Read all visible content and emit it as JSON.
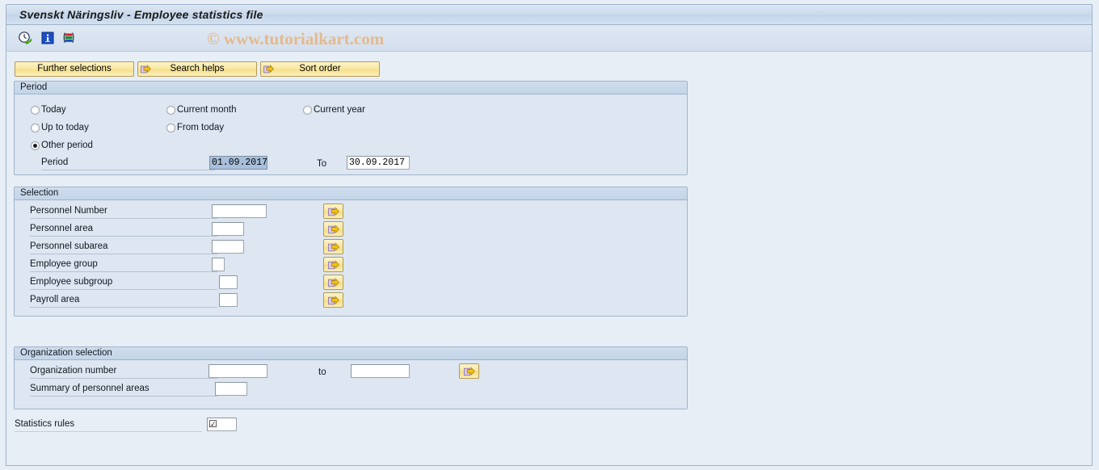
{
  "window": {
    "title": "Svenskt Näringsliv - Employee statistics file"
  },
  "toolbar": {
    "icons": [
      {
        "name": "execute-clock-icon",
        "title": "Execute"
      },
      {
        "name": "info-icon",
        "title": "Information"
      },
      {
        "name": "variant-icon",
        "title": "Get Variant"
      }
    ],
    "watermark": "© www.tutorialkart.com"
  },
  "buttons": [
    {
      "label": "Further selections",
      "icon": null
    },
    {
      "label": "Search helps",
      "icon": "arrow-right-icon"
    },
    {
      "label": "Sort order",
      "icon": "arrow-right-icon"
    }
  ],
  "period": {
    "title": "Period",
    "options": [
      {
        "label": "Today",
        "selected": false
      },
      {
        "label": "Current month",
        "selected": false
      },
      {
        "label": "Current year",
        "selected": false
      },
      {
        "label": "Up to today",
        "selected": false
      },
      {
        "label": "From today",
        "selected": false
      },
      {
        "label": "Other period",
        "selected": true
      }
    ],
    "period_label": "Period",
    "period_from": "01.09.2017",
    "to_label": "To",
    "period_to": "30.09.2017"
  },
  "selection": {
    "title": "Selection",
    "rows": [
      {
        "label": "Personnel Number",
        "value": "",
        "field_width": 68
      },
      {
        "label": "Personnel area",
        "value": "",
        "field_width": 40
      },
      {
        "label": "Personnel subarea",
        "value": "",
        "field_width": 40
      },
      {
        "label": "Employee group",
        "value": "",
        "field_width": 16
      },
      {
        "label": "Employee subgroup",
        "value": "",
        "field_width": 23
      },
      {
        "label": "Payroll area",
        "value": "",
        "field_width": 23
      }
    ],
    "multi_select_icon": "arrow-right-icon"
  },
  "organization": {
    "title": "Organization selection",
    "org_number_label": "Organization number",
    "org_number_from": "",
    "to_label": "to",
    "org_number_to": "",
    "summary_label": "Summary of personnel areas",
    "summary_value": "",
    "multi_select_icon": "arrow-right-icon"
  },
  "statistics": {
    "label": "Statistics rules",
    "value": "☑"
  },
  "colors": {
    "background": "#e8eef6",
    "panel": "#dde6f1",
    "panel_border": "#9eb4cd",
    "button_yellow": "#f9e9a4",
    "selection_blue": "#a8c0dc",
    "watermark": "#e5b98a"
  }
}
